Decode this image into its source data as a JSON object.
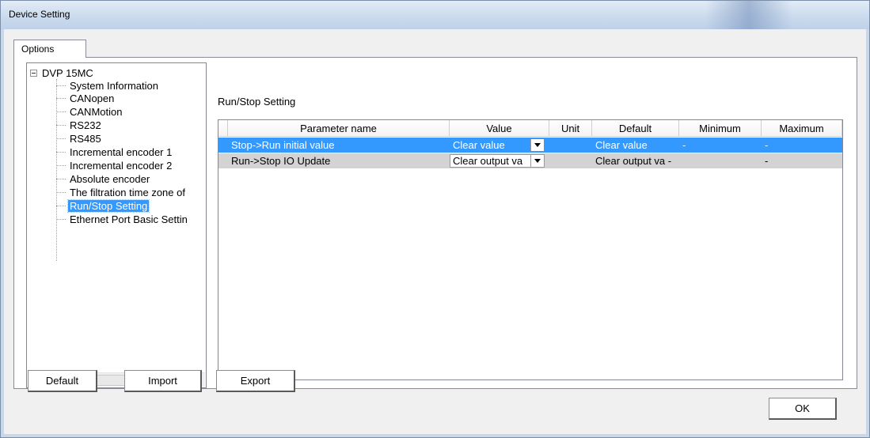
{
  "window": {
    "title": "Device Setting"
  },
  "tabs": [
    {
      "label": "Options"
    }
  ],
  "tree": {
    "root": "DVP 15MC",
    "items": [
      {
        "label": "System Information",
        "selected": false
      },
      {
        "label": "CANopen",
        "selected": false
      },
      {
        "label": "CANMotion",
        "selected": false
      },
      {
        "label": "RS232",
        "selected": false
      },
      {
        "label": "RS485",
        "selected": false
      },
      {
        "label": "Incremental encoder 1",
        "selected": false
      },
      {
        "label": "Incremental encoder 2",
        "selected": false
      },
      {
        "label": "Absolute encoder",
        "selected": false
      },
      {
        "label": "The filtration time zone of",
        "selected": false
      },
      {
        "label": "Run/Stop Setting",
        "selected": true
      },
      {
        "label": "Ethernet Port Basic Settin",
        "selected": false
      }
    ]
  },
  "main": {
    "section_title": "Run/Stop Setting",
    "columns": [
      "Parameter name",
      "Value",
      "Unit",
      "Default",
      "Minimum",
      "Maximum"
    ],
    "rows": [
      {
        "name": "Stop->Run initial value",
        "value": "Clear value",
        "unit": "",
        "default": "Clear value",
        "minimum": "-",
        "maximum": "-",
        "selected": true
      },
      {
        "name": "Run->Stop IO Update",
        "value": "Clear output va",
        "unit": "",
        "default": "Clear output va -",
        "minimum": "",
        "maximum": "-",
        "selected": false
      }
    ]
  },
  "buttons": {
    "default": "Default",
    "import": "Import",
    "export": "Export",
    "ok": "OK"
  },
  "colors": {
    "selection": "#3399ff",
    "row_normal": "#d3d3d3",
    "titlebar": "#cddcee"
  }
}
